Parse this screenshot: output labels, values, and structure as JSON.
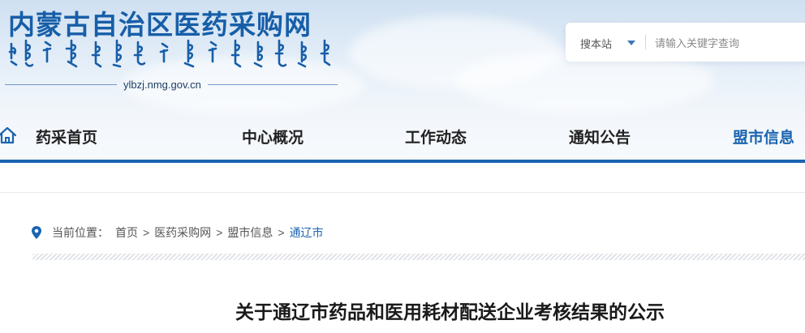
{
  "site": {
    "title": "内蒙古自治区医药采购网",
    "domain": "ylbzj.nmg.gov.cn",
    "brand_color": "#175ea8"
  },
  "search": {
    "scope_label": "搜本站",
    "placeholder": "请输入关键字查询",
    "value": ""
  },
  "nav": {
    "home_label": "药采首页",
    "items": [
      {
        "label": "中心概况"
      },
      {
        "label": "工作动态"
      },
      {
        "label": "通知公告"
      },
      {
        "label": "盟市信息",
        "active": true
      }
    ],
    "accent": "#1b64b0"
  },
  "breadcrumb": {
    "prefix": "当前位置：",
    "items": [
      "首页",
      "医药采购网",
      "盟市信息"
    ],
    "current": "通辽市",
    "separator": ">"
  },
  "article": {
    "title": "关于通辽市药品和医用耗材配送企业考核结果的公示"
  }
}
